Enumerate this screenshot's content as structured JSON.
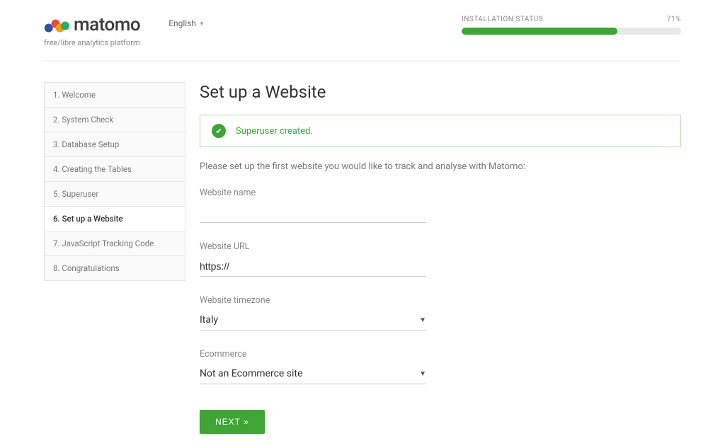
{
  "header": {
    "brand": "matomo",
    "tagline": "free/libre analytics platform",
    "language": "English",
    "progress_label": "INSTALLATION STATUS",
    "progress_pct_text": "71%",
    "progress_pct": 71
  },
  "sidebar": {
    "steps": [
      "1. Welcome",
      "2. System Check",
      "3. Database Setup",
      "4. Creating the Tables",
      "5. Superuser",
      "6. Set up a Website",
      "7. JavaScript Tracking Code",
      "8. Congratulations"
    ],
    "active_index": 5
  },
  "main": {
    "title": "Set up a Website",
    "notice": "Superuser created.",
    "intro": "Please set up the first website you would like to track and analyse with Matomo:",
    "fields": {
      "name_label": "Website name",
      "name_value": "",
      "url_label": "Website URL",
      "url_value": "https://",
      "tz_label": "Website timezone",
      "tz_value": "Italy",
      "ecom_label": "Ecommerce",
      "ecom_value": "Not an Ecommerce site"
    },
    "next_button": "NEXT »"
  }
}
